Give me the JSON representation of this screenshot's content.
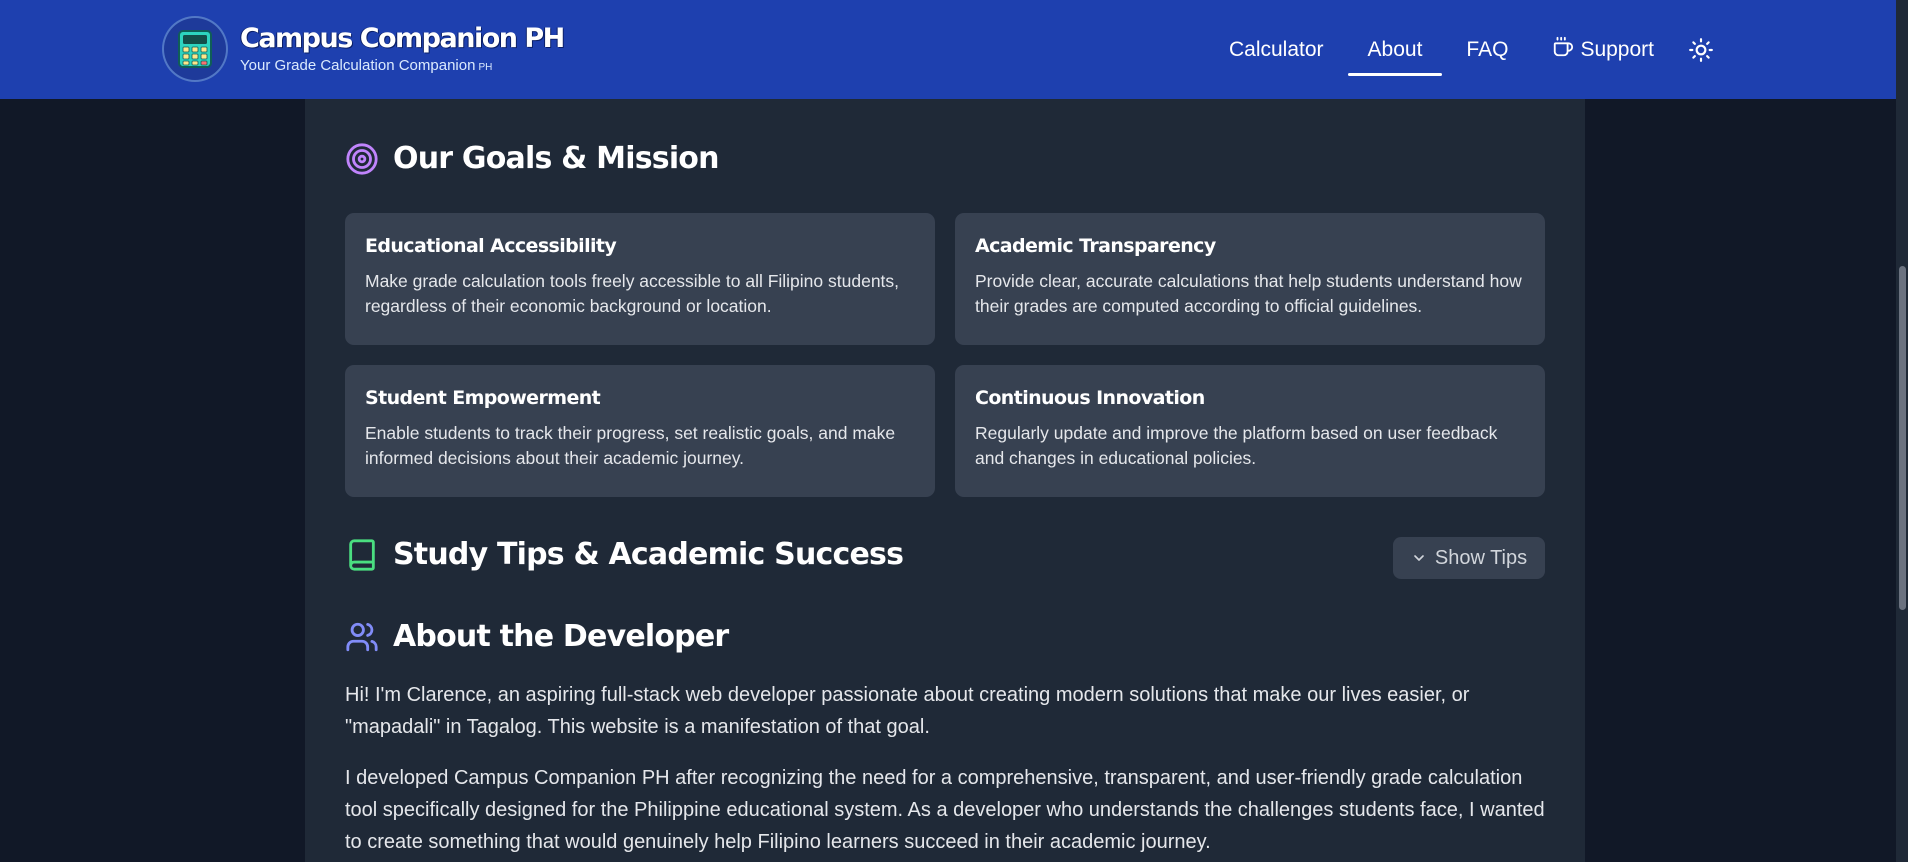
{
  "header": {
    "brand_title": "Campus Companion PH",
    "brand_subtitle": "Your Grade Calculation Companion",
    "brand_subtitle_suffix": "PH",
    "nav": {
      "calculator": "Calculator",
      "about": "About",
      "faq": "FAQ",
      "support": "Support"
    },
    "active_nav": "About",
    "icons": {
      "logo": "calculator-icon",
      "support": "coffee-icon",
      "theme": "sun-icon"
    }
  },
  "goals": {
    "title": "Our Goals & Mission",
    "icon": "target-icon",
    "cards": [
      {
        "title": "Educational Accessibility",
        "desc": "Make grade calculation tools freely accessible to all Filipino students, regardless of their economic background or location."
      },
      {
        "title": "Academic Transparency",
        "desc": "Provide clear, accurate calculations that help students understand how their grades are computed according to official guidelines."
      },
      {
        "title": "Student Empowerment",
        "desc": "Enable students to track their progress, set realistic goals, and make informed decisions about their academic journey."
      },
      {
        "title": "Continuous Innovation",
        "desc": "Regularly update and improve the platform based on user feedback and changes in educational policies."
      }
    ]
  },
  "tips": {
    "title": "Study Tips & Academic Success",
    "icon": "book-icon",
    "button": "Show Tips"
  },
  "developer": {
    "title": "About the Developer",
    "icon": "users-icon",
    "paragraphs": [
      "Hi! I'm Clarence, an aspiring full-stack web developer passionate about creating modern solutions that make our lives easier, or \"mapadali\" in Tagalog. This website is a manifestation of that goal.",
      "I developed Campus Companion PH after recognizing the need for a comprehensive, transparent, and user-friendly grade calculation tool specifically designed for the Philippine educational system. As a developer who understands the challenges students face, I wanted to create something that would genuinely help Filipino learners succeed in their academic journey."
    ]
  },
  "colors": {
    "navbar": "#1e40af",
    "page_bg": "#111827",
    "panel_bg": "#1f2937",
    "card_bg": "#374151",
    "goals_icon": "#c084fc",
    "tips_icon": "#4ade80",
    "dev_icon": "#818cf8"
  }
}
